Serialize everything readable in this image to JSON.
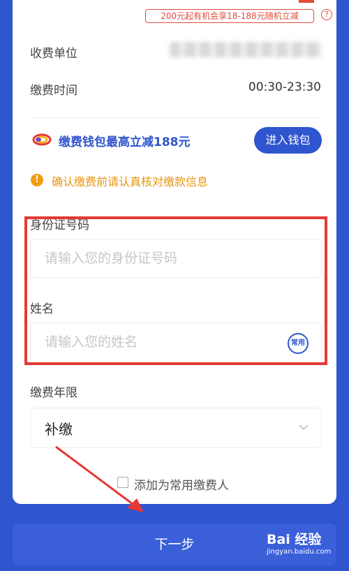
{
  "promo": {
    "tag": "200元起有机会享18-188元随机立减",
    "help_icon": "question-icon"
  },
  "info": {
    "payee_label": "收费单位",
    "payment_time_label": "缴费时间",
    "payment_time_value": "00:30-23:30"
  },
  "wallet": {
    "text": "缴费钱包最高立减188元",
    "button": "进入钱包",
    "icon": "wallet-logo-icon"
  },
  "notice": {
    "text": "确认缴费前请认真核对缴款信息",
    "icon": "info-icon"
  },
  "form": {
    "id_label": "身份证号码",
    "id_placeholder": "请输入您的身份证号码",
    "name_label": "姓名",
    "name_placeholder": "请输入您的姓名",
    "common_button": "常用",
    "year_label": "缴费年限",
    "year_value": "补缴"
  },
  "checkbox": {
    "label": "添加为常用缴费人"
  },
  "actions": {
    "next": "下一步"
  },
  "watermark": {
    "main": "Bai 经验",
    "sub": "jingyan.baidu.com"
  },
  "colors": {
    "primary": "#2f55cf",
    "accent_red": "#e04b3b",
    "warning": "#f39c12"
  }
}
